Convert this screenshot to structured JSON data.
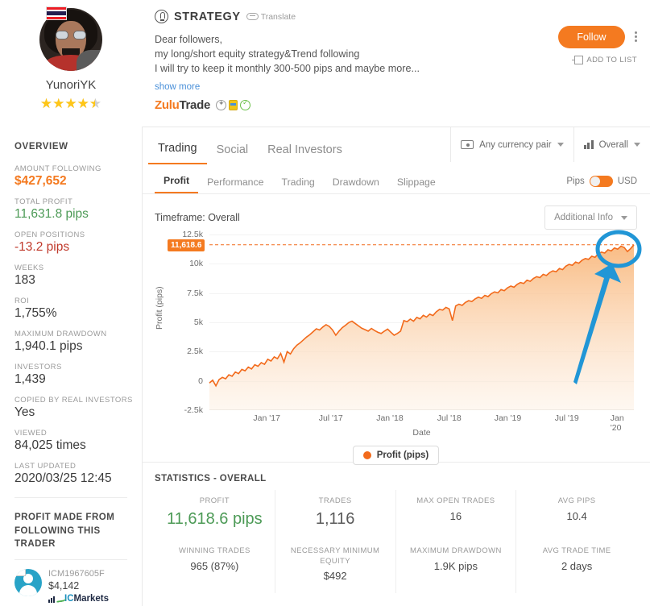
{
  "profile": {
    "username": "YunoriYK",
    "country_flag": "thailand-flag",
    "rating_stars": 4.5,
    "stars_glyphs": "★★★★★"
  },
  "header": {
    "icon": "lightbulb-icon",
    "title": "STRATEGY",
    "translate_label": "Translate",
    "description_lines": [
      "Dear followers,",
      "my  long/short equity strategy&Trend following",
      "I will try to keep it monthly 300-500 pips and maybe more..."
    ],
    "show_more": "show more",
    "brand_zulu": "Zulu",
    "brand_trade": "Trade",
    "follow_label": "Follow",
    "add_to_list_label": "ADD TO LIST",
    "accent_color": "#f47a20"
  },
  "sidebar": {
    "title": "OVERVIEW",
    "stats": [
      {
        "label": "AMOUNT FOLLOWING",
        "value": "$427,652",
        "tone": "orange"
      },
      {
        "label": "TOTAL PROFIT",
        "value": "11,631.8 pips",
        "tone": "green"
      },
      {
        "label": "OPEN POSITIONS",
        "value": "-13.2 pips",
        "tone": "red"
      },
      {
        "label": "WEEKS",
        "value": "183",
        "tone": "plain"
      },
      {
        "label": "ROI",
        "value": "1,755%",
        "tone": "plain"
      },
      {
        "label": "MAXIMUM DRAWDOWN",
        "value": "1,940.1 pips",
        "tone": "plain"
      },
      {
        "label": "INVESTORS",
        "value": "1,439",
        "tone": "plain"
      },
      {
        "label": "COPIED BY REAL INVESTORS",
        "value": "Yes",
        "tone": "plain"
      },
      {
        "label": "VIEWED",
        "value": "84,025 times",
        "tone": "plain"
      },
      {
        "label": "LAST UPDATED",
        "value": "2020/03/25 12:45",
        "tone": "plain"
      }
    ],
    "profit_made_title": "PROFIT MADE FROM FOLLOWING THIS TRADER",
    "investor": {
      "id": "ICM1967605F",
      "amount": "$4,142",
      "broker_c": "IC",
      "broker_name": "Markets"
    }
  },
  "tabs": {
    "main": [
      {
        "label": "Trading",
        "active": true
      },
      {
        "label": "Social",
        "active": false
      },
      {
        "label": "Real Investors",
        "active": false
      }
    ],
    "selectors": [
      {
        "icon": "money-icon",
        "label": "Any currency pair"
      },
      {
        "icon": "bar-chart-icon",
        "label": "Overall"
      }
    ],
    "sub": [
      {
        "label": "Profit",
        "active": true
      },
      {
        "label": "Performance",
        "active": false
      },
      {
        "label": "Trading",
        "active": false
      },
      {
        "label": "Drawdown",
        "active": false
      },
      {
        "label": "Slippage",
        "active": false
      }
    ],
    "unit_left": "Pips",
    "unit_right": "USD"
  },
  "chart_panel": {
    "timeframe": "Timeframe: Overall",
    "additional_info": "Additional Info",
    "peak_badge": "11,618.6"
  },
  "chart_data": {
    "type": "area",
    "title": "",
    "xlabel": "Date",
    "ylabel": "Profit (pips)",
    "ylim": [
      -2500,
      12500
    ],
    "yticks": [
      -2500,
      0,
      2500,
      5000,
      7500,
      10000,
      12500
    ],
    "ytick_labels": [
      "-2.5k",
      "0",
      "2.5k",
      "5k",
      "7.5k",
      "10k",
      "12.5k"
    ],
    "xticks": [
      "Jan '17",
      "Jul '17",
      "Jan '18",
      "Jul '18",
      "Jan '19",
      "Jul '19",
      "Jan '20"
    ],
    "xlim": [
      "2016-09",
      "2020-03"
    ],
    "grid": true,
    "legend_position": "bottom",
    "series": [
      {
        "name": "Profit (pips)",
        "color": "#f26a1b",
        "fill": "#fbd0ac",
        "reference_line": 11618.6,
        "final_value": 11618.6,
        "values": [
          -180,
          60,
          -420,
          120,
          300,
          180,
          520,
          400,
          760,
          620,
          980,
          860,
          1180,
          1020,
          1380,
          1250,
          1560,
          1420,
          1850,
          1700,
          2050,
          1900,
          2350,
          1600,
          2500,
          2300,
          2750,
          3050,
          3250,
          3500,
          3750,
          3950,
          4200,
          4450,
          4350,
          4600,
          4800,
          4650,
          4350,
          3900,
          4250,
          4550,
          4750,
          4980,
          5100,
          4900,
          4700,
          4500,
          4380,
          4250,
          4480,
          4300,
          4150,
          4050,
          4250,
          4420,
          4150,
          3900,
          4050,
          4250,
          5150,
          5050,
          5280,
          5100,
          5420,
          5300,
          5600,
          5450,
          5700,
          5580,
          5900,
          6100,
          6050,
          6280,
          6150,
          5150,
          6400,
          6550,
          6450,
          6700,
          6850,
          6780,
          7000,
          7150,
          7050,
          7300,
          7200,
          7450,
          7600,
          7520,
          7800,
          7700,
          7950,
          8100,
          8000,
          8250,
          8400,
          8320,
          8600,
          8500,
          8750,
          8900,
          8820,
          9100,
          9000,
          9250,
          9400,
          9320,
          9600,
          9500,
          9800,
          9950,
          9870,
          10150,
          10050,
          10300,
          10450,
          10380,
          10650,
          10550,
          10850,
          11000,
          10920,
          11200,
          11100,
          11350,
          11250,
          11500,
          11400,
          11050,
          11300,
          11618.6
        ]
      }
    ],
    "annotations": [
      {
        "type": "circle",
        "target": "final-data-point",
        "color": "#2196d6"
      },
      {
        "type": "arrow",
        "target": "final-data-point",
        "color": "#2196d6"
      }
    ]
  },
  "statistics": {
    "title": "STATISTICS - OVERALL",
    "cells": [
      {
        "key": "PROFIT",
        "value": "11,618.6 pips",
        "style": "big"
      },
      {
        "key": "TRADES",
        "value": "1,116",
        "style": "big2"
      },
      {
        "key": "MAX OPEN TRADES",
        "value": "16",
        "style": "normal"
      },
      {
        "key": "AVG PIPS",
        "value": "10.4",
        "style": "normal"
      },
      {
        "key": "WINNING TRADES",
        "value": "965 (87%)",
        "style": "normal"
      },
      {
        "key": "NECESSARY MINIMUM EQUITY",
        "value": "$492",
        "style": "normal"
      },
      {
        "key": "MAXIMUM DRAWDOWN",
        "value": "1.9K pips",
        "style": "normal"
      },
      {
        "key": "AVG TRADE TIME",
        "value": "2 days",
        "style": "normal"
      }
    ]
  }
}
